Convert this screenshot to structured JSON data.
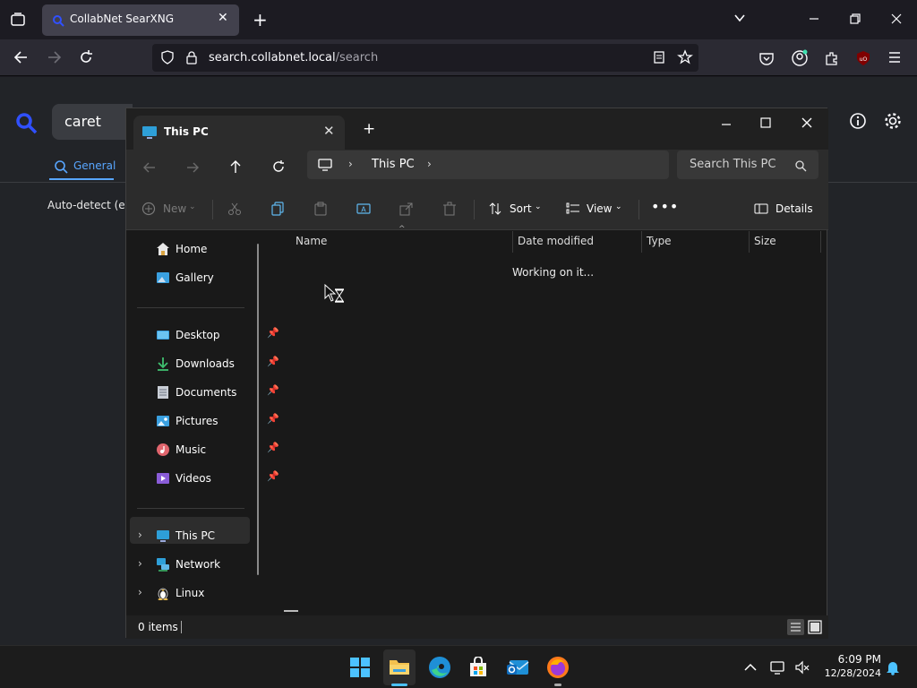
{
  "browser": {
    "tab_title": "CollabNet SearXNG",
    "url_host": "search.collabnet.local",
    "url_path": "/search"
  },
  "searx": {
    "query": "caret",
    "tab_general": "General",
    "auto_detect": "Auto-detect (er"
  },
  "explorer": {
    "tab_title": "This PC",
    "breadcrumb": "This PC",
    "search_placeholder": "Search This PC",
    "toolbar": {
      "new": "New",
      "sort": "Sort",
      "view": "View",
      "details": "Details"
    },
    "nav": {
      "home": "Home",
      "gallery": "Gallery",
      "desktop": "Desktop",
      "downloads": "Downloads",
      "documents": "Documents",
      "pictures": "Pictures",
      "music": "Music",
      "videos": "Videos",
      "this_pc": "This PC",
      "network": "Network",
      "linux": "Linux"
    },
    "columns": {
      "name": "Name",
      "date": "Date modified",
      "type": "Type",
      "size": "Size"
    },
    "status_working": "Working on it...",
    "item_count": "0 items"
  },
  "taskbar": {
    "time": "6:09 PM",
    "date": "12/28/2024"
  },
  "colors": {
    "accent": "#58a6ff",
    "folder": "#f2c14e",
    "selection": "#2d2d2d"
  }
}
